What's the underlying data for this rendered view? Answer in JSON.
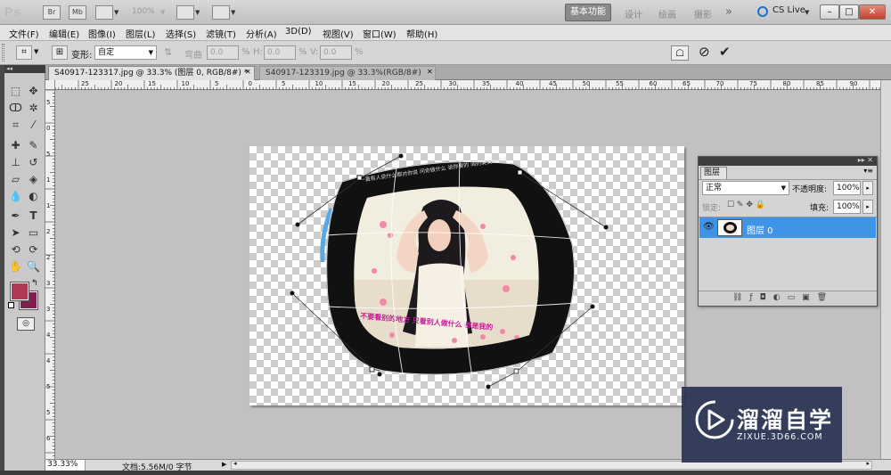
{
  "app": {
    "logo": "Ps",
    "bridge_icon": "Br",
    "minibridge_icon": "Mb",
    "zoom_level": "100%",
    "workspaces": [
      "基本功能",
      "设计",
      "绘画",
      "摄影"
    ],
    "active_workspace": "基本功能",
    "more_workspaces": "»",
    "cs_live": "CS Live",
    "window_buttons": [
      "–",
      "□",
      "✕"
    ]
  },
  "menu": [
    "文件(F)",
    "编辑(E)",
    "图像(I)",
    "图层(L)",
    "选择(S)",
    "滤镜(T)",
    "分析(A)",
    "3D(D)",
    "视图(V)",
    "窗口(W)",
    "帮助(H)"
  ],
  "options": {
    "warp_label": "变形:",
    "warp_value": "自定",
    "bend_label": "弯曲",
    "bend_value": "0.0",
    "bend_unit": "%",
    "h_label": "H:",
    "h_value": "0.0",
    "h_unit": "%",
    "v_label": "V:",
    "v_value": "0.0",
    "v_unit": "%",
    "cancel_icon": "⊘",
    "commit_icon": "✔"
  },
  "tabs": [
    {
      "label": "S40917-123317.jpg @ 33.3% (图层 0, RGB/8#) *",
      "close": "✕",
      "active": true
    },
    {
      "label": "S40917-123319.jpg @ 33.3%(RGB/8#)",
      "close": "✕",
      "active": false
    }
  ],
  "ruler": {
    "h_numbers": [
      "25",
      "20",
      "15",
      "10",
      "5",
      "0",
      "5",
      "10",
      "15",
      "20",
      "25",
      "30",
      "35",
      "40",
      "45",
      "50",
      "55",
      "60",
      "65",
      "70",
      "75",
      "80",
      "85",
      "90"
    ],
    "v_numbers": [
      "5",
      "0",
      "5",
      "1",
      "1",
      "2",
      "2",
      "3",
      "3",
      "4",
      "4",
      "5",
      "5",
      "6"
    ]
  },
  "canvas": {
    "overlay_text_top": "一直有人说什么都对你说 问你做什么 说你要的 闻的美女的河流",
    "overlay_text_bottom": "不要看别的地方 只看别人做什么 都是我的"
  },
  "layers_panel": {
    "title": "图层",
    "blend_mode": "正常",
    "opacity_label": "不透明度:",
    "opacity_value": "100%",
    "lock_label": "锁定:",
    "fill_label": "填充:",
    "fill_value": "100%",
    "layer_name": "图层 0",
    "bottom_icons": [
      "link-icon",
      "fx-icon",
      "mask-icon",
      "adjustment-icon",
      "folder-icon",
      "new-layer-icon",
      "trash-icon"
    ]
  },
  "status": {
    "zoom": "33.33%",
    "doc_info": "文档:5.56M/0 字节"
  },
  "watermark": {
    "title": "溜溜自学",
    "url": "ZIXUE.3D66.COM"
  },
  "colors": {
    "foreground": "#b03a55",
    "background": "#7d1f4f",
    "selection": "#3f94e8",
    "watermark_bg": "#2a3554"
  }
}
